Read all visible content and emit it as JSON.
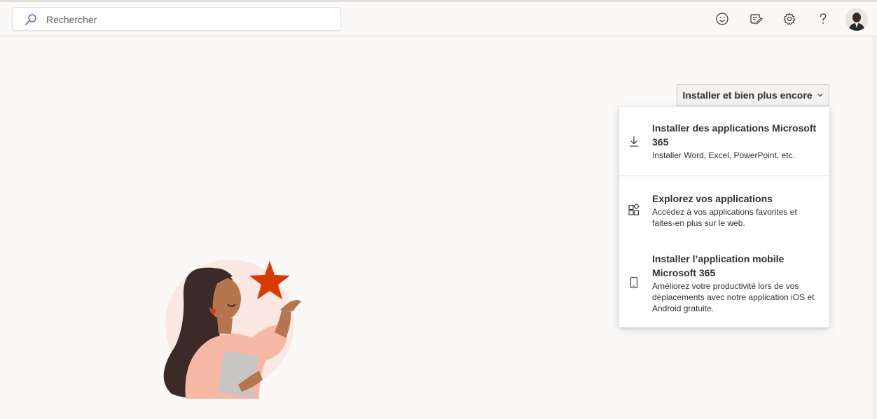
{
  "search": {
    "placeholder": "Rechercher"
  },
  "header": {
    "icons": [
      "feedback-smiley-icon",
      "whats-new-icon",
      "settings-gear-icon",
      "help-icon"
    ],
    "avatar": "user-avatar"
  },
  "install_button": {
    "label": "Installer et bien plus encore"
  },
  "menu": {
    "items": [
      {
        "icon": "download-icon",
        "title": "Installer des applications Microsoft 365",
        "description": "Installer Word, Excel, PowerPoint, etc."
      },
      {
        "icon": "apps-grid-icon",
        "title": "Explorez vos applications",
        "description": "Accédez à vos applications favorites et faites-en plus sur le web."
      },
      {
        "icon": "mobile-phone-icon",
        "title": "Installer l’application mobile Microsoft 365",
        "description": "Améliorez votre productivité lors de vos déplacements avec notre application iOS et Android gratuite."
      }
    ]
  },
  "colors": {
    "accent_star": "#d83b01",
    "page_bg": "#faf9f8"
  }
}
